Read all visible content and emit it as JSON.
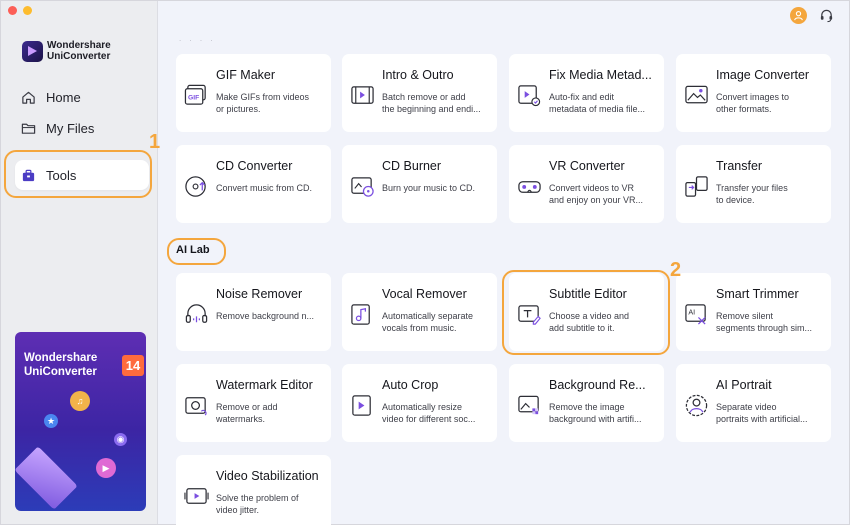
{
  "app": {
    "brand_line1": "Wondershare",
    "brand_line2": "UniConverter"
  },
  "sidebar": {
    "items": [
      {
        "label": "Home",
        "icon": "home-icon"
      },
      {
        "label": "My Files",
        "icon": "folder-icon"
      },
      {
        "label": "Tools",
        "icon": "toolbox-icon",
        "active": true
      }
    ]
  },
  "promo": {
    "line1": "Wondershare",
    "line2": "UniConverter",
    "version": "14"
  },
  "annotations": {
    "marker1": "1",
    "marker2": "2"
  },
  "header": {
    "faded_heading": ". . . ."
  },
  "tools": [
    {
      "title": "GIF Maker",
      "desc": [
        "Make GIFs from videos",
        "or pictures."
      ],
      "icon": "gif-icon"
    },
    {
      "title": "Intro & Outro",
      "desc": [
        "Batch remove or add",
        "the beginning and endi..."
      ],
      "icon": "intro-outro-icon"
    },
    {
      "title": "Fix Media Metad...",
      "desc": [
        "Auto-fix and edit",
        "metadata of media file..."
      ],
      "icon": "metadata-icon"
    },
    {
      "title": "Image Converter",
      "desc": [
        "Convert images to",
        "other formats."
      ],
      "icon": "image-icon"
    },
    {
      "title": "CD Converter",
      "desc": [
        "Convert music from CD."
      ],
      "icon": "cd-icon"
    },
    {
      "title": "CD Burner",
      "desc": [
        "Burn your music to CD."
      ],
      "icon": "cd-burner-icon"
    },
    {
      "title": "VR Converter",
      "desc": [
        "Convert videos to VR",
        "and enjoy on your VR..."
      ],
      "icon": "vr-icon"
    },
    {
      "title": "Transfer",
      "desc": [
        "Transfer your files",
        "to device."
      ],
      "icon": "transfer-icon"
    }
  ],
  "ai_lab": {
    "label": "AI Lab",
    "tools": [
      {
        "title": "Noise Remover",
        "desc": [
          "Remove background n..."
        ],
        "icon": "headphones-icon"
      },
      {
        "title": "Vocal Remover",
        "desc": [
          "Automatically separate",
          "vocals from music."
        ],
        "icon": "music-note-icon"
      },
      {
        "title": "Subtitle Editor",
        "desc": [
          "Choose a video and",
          "add subtitle to it."
        ],
        "icon": "subtitle-icon"
      },
      {
        "title": "Smart Trimmer",
        "desc": [
          "Remove silent",
          "segments through sim..."
        ],
        "icon": "ai-trim-icon"
      },
      {
        "title": "Watermark Editor",
        "desc": [
          "Remove or add",
          "watermarks."
        ],
        "icon": "watermark-icon"
      },
      {
        "title": "Auto Crop",
        "desc": [
          "Automatically resize",
          "video for different soc..."
        ],
        "icon": "crop-icon"
      },
      {
        "title": "Background Re...",
        "desc": [
          "Remove the image",
          "background with artifi..."
        ],
        "icon": "background-icon"
      },
      {
        "title": "AI Portrait",
        "desc": [
          "Separate video",
          "portraits with artificial..."
        ],
        "icon": "portrait-icon"
      },
      {
        "title": "Video Stabilization",
        "desc": [
          "Solve the problem of",
          "video jitter."
        ],
        "icon": "stabilize-icon"
      }
    ]
  },
  "colors": {
    "accent": "#f4a63d",
    "icon_purple": "#7b4fe0",
    "background": "#f1f3fa"
  }
}
